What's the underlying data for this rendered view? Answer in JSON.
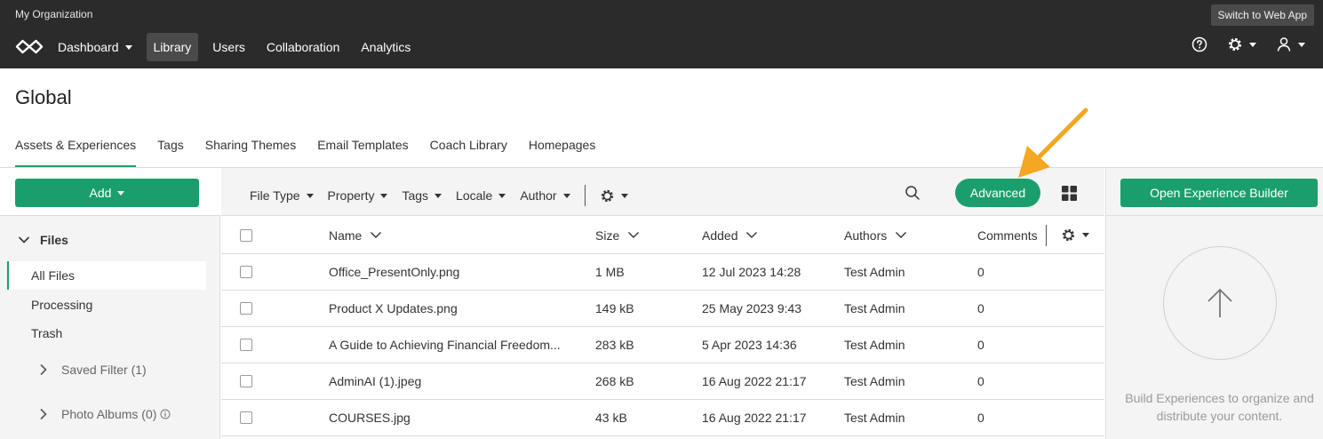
{
  "header": {
    "org_name": "My Organization",
    "switch_label": "Switch to Web App",
    "nav": [
      {
        "label": "Dashboard",
        "has_caret": true
      },
      {
        "label": "Library",
        "active": true
      },
      {
        "label": "Users"
      },
      {
        "label": "Collaboration"
      },
      {
        "label": "Analytics"
      }
    ],
    "icons": [
      "help-icon",
      "gear-icon",
      "user-icon"
    ]
  },
  "page": {
    "title": "Global",
    "tabs": [
      "Assets & Experiences",
      "Tags",
      "Sharing Themes",
      "Email Templates",
      "Coach Library",
      "Homepages"
    ],
    "active_tab": "Assets & Experiences"
  },
  "sidebar": {
    "add_label": "Add",
    "files_label": "Files",
    "items": [
      "All Files",
      "Processing",
      "Trash"
    ],
    "saved_filter": "Saved Filter (1)",
    "photo_albums": "Photo Albums (0)"
  },
  "toolbar": {
    "filters": [
      "File Type",
      "Property",
      "Tags",
      "Locale",
      "Author"
    ],
    "advanced_label": "Advanced"
  },
  "table": {
    "columns": [
      "Name",
      "Size",
      "Added",
      "Authors",
      "Comments"
    ],
    "rows": [
      {
        "name": "Office_PresentOnly.png",
        "size": "1 MB",
        "added": "12 Jul 2023 14:28",
        "authors": "Test Admin",
        "comments": "0"
      },
      {
        "name": "Product X Updates.png",
        "size": "149 kB",
        "added": "25 May 2023 9:43",
        "authors": "Test Admin",
        "comments": "0"
      },
      {
        "name": "A Guide to Achieving Financial Freedom...",
        "size": "283 kB",
        "added": "5 Apr 2023 14:36",
        "authors": "Test Admin",
        "comments": "0"
      },
      {
        "name": "AdminAI (1).jpeg",
        "size": "268 kB",
        "added": "16 Aug 2022 21:17",
        "authors": "Test Admin",
        "comments": "0"
      },
      {
        "name": "COURSES.jpg",
        "size": "43 kB",
        "added": "16 Aug 2022 21:17",
        "authors": "Test Admin",
        "comments": "0"
      }
    ]
  },
  "right_panel": {
    "button_label": "Open Experience Builder",
    "hint": "Build Experiences to organize and distribute your content."
  },
  "colors": {
    "accent": "#1a9f6c",
    "topbar": "#2b2b2b",
    "annotation_arrow": "#f5a623"
  }
}
